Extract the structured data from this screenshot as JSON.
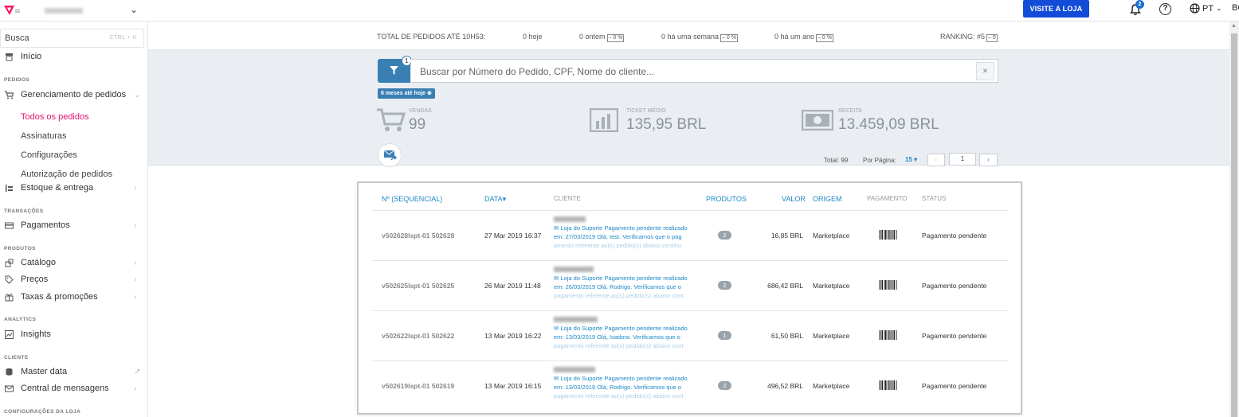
{
  "topbar": {
    "visit_label": "VISITE A LOJA",
    "notifications": "2",
    "help": "?",
    "lang": "PT",
    "user_initials": "BC"
  },
  "sidebar": {
    "search_label": "Busca",
    "search_shortcut": "CTRL + K",
    "home": "Início",
    "sec_orders": "PEDIDOS",
    "orders_mgmt": "Gerenciamento de pedidos",
    "sub_all_orders": "Todos os pedidos",
    "sub_subscriptions": "Assinaturas",
    "sub_settings": "Configurações",
    "sub_authorization": "Autorização de pedidos",
    "stock": "Estoque & entrega",
    "sec_transactions": "TRANSAÇÕES",
    "payments": "Pagamentos",
    "sec_products": "PRODUTOS",
    "catalog": "Catálogo",
    "prices": "Preços",
    "taxes": "Taxas & promoções",
    "sec_analytics": "ANALYTICS",
    "insights": "Insights",
    "sec_client": "CLIENTE",
    "master_data": "Master data",
    "messages": "Central de mensagens",
    "sec_store": "CONFIGURAÇÕES DA LOJA"
  },
  "stats": {
    "total_label": "TOTAL DE PEDIDOS ATÉ",
    "time": "10H53:",
    "today": "0 hoje",
    "yesterday": "0 ontem",
    "week": "0 há uma semana",
    "year": "0 há um ano",
    "delta": "– 0 %",
    "ranking": "RANKING: #5",
    "ranking_delta": "– 0"
  },
  "search": {
    "placeholder": "Buscar por Número do Pedido, CPF, Nome do cliente...",
    "filter_count": "1",
    "date_chip": "6 meses até hoje",
    "clear": "✕"
  },
  "kpis": {
    "sales_label": "VENDAS",
    "sales_value": "99",
    "ticket_label": "TICKET MÉDIO",
    "ticket_value": "135,95 BRL",
    "revenue_label": "RECEITA",
    "revenue_value": "13.459,09 BRL"
  },
  "pager": {
    "total": "Total: 99",
    "per_page_label": "Por Página:",
    "per_page_value": "15",
    "page": "1"
  },
  "table": {
    "headers": [
      "Nº (SEQUENCIAL)",
      "DATA",
      "CLIENTE",
      "PRODUTOS",
      "VALOR",
      "ORIGEM",
      "PAGAMENTO",
      "STATUS"
    ],
    "rows": [
      {
        "id": "v502628lspt-01 502628",
        "date": "27 Mar 2019 16:37",
        "msg1": "Loja do Suporte Pagamento pendente realizado em: 27/03/2019 Olá, test. Verificamos que o pag",
        "msg2": "amento referente ao(s) pedido(s) abaixo continu",
        "products": "2",
        "value": "16,85 BRL",
        "origin": "Marketplace",
        "status": "Pagamento pendente"
      },
      {
        "id": "v502625lspt-01 502625",
        "date": "26 Mar 2019 11:48",
        "msg1": "Loja do Suporte Pagamento pendente realizado em: 26/03/2019 Olá, Rodrigo. Verificamos que o",
        "msg2": "pagamento referente ao(s) pedido(s) abaixo cont",
        "products": "2",
        "value": "686,42 BRL",
        "origin": "Marketplace",
        "status": "Pagamento pendente"
      },
      {
        "id": "v502622lspt-01 502622",
        "date": "13 Mar 2019 16:22",
        "msg1": "Loja do Suporte Pagamento pendente realizado em: 13/03/2019 Olá, Isadora. Verificamos que o",
        "msg2": "pagamento referente ao(s) pedido(s) abaixo cont",
        "products": "1",
        "value": "61,50 BRL",
        "origin": "Marketplace",
        "status": "Pagamento pendente"
      },
      {
        "id": "v502619lspt-01 502619",
        "date": "13 Mar 2019 16:15",
        "msg1": "Loja do Suporte Pagamento pendente realizado em: 13/03/2019 Olá, Rodrigo. Verificamos que o",
        "msg2": "pagamento referente ao(s) pedido(s) abaixo cont",
        "products": "2",
        "value": "496,52 BRL",
        "origin": "Marketplace",
        "status": "Pagamento pendente"
      }
    ]
  },
  "colors": {
    "accent": "#134cd8",
    "active_link": "#e2136e",
    "link": "#1e88c8",
    "filter": "#3a7fb3"
  }
}
